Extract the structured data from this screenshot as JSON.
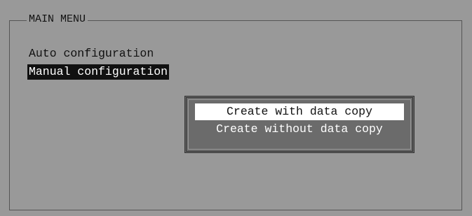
{
  "menu": {
    "title": "MAIN MENU",
    "items": [
      {
        "label": "Auto configuration",
        "selected": false
      },
      {
        "label": "Manual configuration",
        "selected": true
      }
    ]
  },
  "submenu": {
    "items": [
      {
        "label": "Create with data copy",
        "selected": true
      },
      {
        "label": "Create without data copy",
        "selected": false
      }
    ]
  }
}
